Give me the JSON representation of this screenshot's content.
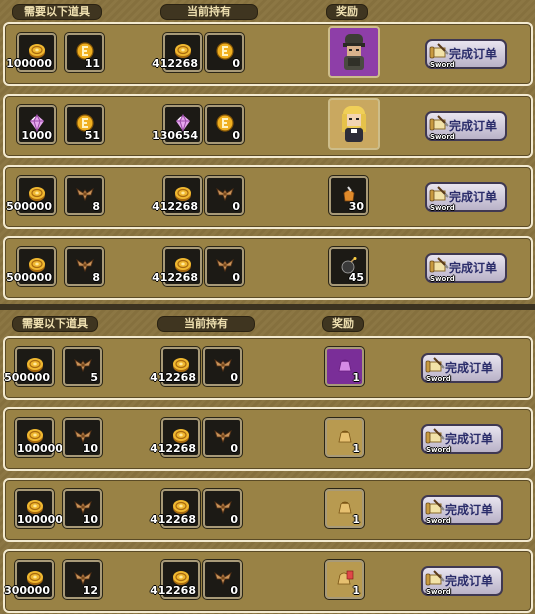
{
  "headers": {
    "required": "需要以下道具",
    "held": "当前持有",
    "reward": "奖励"
  },
  "button": {
    "label": "完成订单",
    "sub": "Sword"
  },
  "colors": {
    "coin": "#e8b030",
    "diamond": "#e0a0e8",
    "bat": "#c09060",
    "button_text": "#2a2c6a"
  },
  "rows": [
    {
      "req1": {
        "icon": "coin-icon",
        "value": "100000"
      },
      "req2": {
        "icon": "token-icon",
        "value": "11"
      },
      "held1": {
        "icon": "coin-icon",
        "value": "412268"
      },
      "held2": {
        "icon": "token-icon",
        "value": "0"
      },
      "reward": {
        "icon": "soldier-portrait",
        "value": ""
      }
    },
    {
      "req1": {
        "icon": "diamond-icon",
        "value": "1000"
      },
      "req2": {
        "icon": "token-icon",
        "value": "51"
      },
      "held1": {
        "icon": "diamond-icon",
        "value": "130654"
      },
      "held2": {
        "icon": "token-icon",
        "value": "0"
      },
      "reward": {
        "icon": "blonde-girl-portrait",
        "value": ""
      }
    },
    {
      "req1": {
        "icon": "coin-icon",
        "value": "500000"
      },
      "req2": {
        "icon": "bat-emblem-icon",
        "value": "8"
      },
      "held1": {
        "icon": "coin-icon",
        "value": "412268"
      },
      "held2": {
        "icon": "bat-emblem-icon",
        "value": "0"
      },
      "reward": {
        "icon": "tool-pouch-icon",
        "value": "30"
      }
    },
    {
      "req1": {
        "icon": "coin-icon",
        "value": "500000"
      },
      "req2": {
        "icon": "bat-emblem-icon",
        "value": "8"
      },
      "held1": {
        "icon": "coin-icon",
        "value": "412268"
      },
      "held2": {
        "icon": "bat-emblem-icon",
        "value": "0"
      },
      "reward": {
        "icon": "bomb-icon",
        "value": "45"
      }
    },
    {
      "req1": {
        "icon": "coin-icon",
        "value": "500000"
      },
      "req2": {
        "icon": "bat-emblem-icon",
        "value": "5"
      },
      "held1": {
        "icon": "coin-icon",
        "value": "412268"
      },
      "held2": {
        "icon": "bat-emblem-icon",
        "value": "0"
      },
      "reward": {
        "icon": "purple-bag-icon",
        "value": "1"
      }
    },
    {
      "req1": {
        "icon": "coin-icon",
        "value": "1000000"
      },
      "req2": {
        "icon": "bat-emblem-icon",
        "value": "10"
      },
      "held1": {
        "icon": "coin-icon",
        "value": "412268"
      },
      "held2": {
        "icon": "bat-emblem-icon",
        "value": "0"
      },
      "reward": {
        "icon": "gold-bag-icon",
        "value": "1"
      }
    },
    {
      "req1": {
        "icon": "coin-icon",
        "value": "1000000"
      },
      "req2": {
        "icon": "bat-emblem-icon",
        "value": "10"
      },
      "held1": {
        "icon": "coin-icon",
        "value": "412268"
      },
      "held2": {
        "icon": "bat-emblem-icon",
        "value": "0"
      },
      "reward": {
        "icon": "gold-bag-icon",
        "value": "1"
      }
    },
    {
      "req1": {
        "icon": "coin-icon",
        "value": "300000"
      },
      "req2": {
        "icon": "bat-emblem-icon",
        "value": "12"
      },
      "held1": {
        "icon": "coin-icon",
        "value": "412268"
      },
      "held2": {
        "icon": "bat-emblem-icon",
        "value": "0"
      },
      "reward": {
        "icon": "red-tag-bag-icon",
        "value": "1"
      }
    }
  ]
}
